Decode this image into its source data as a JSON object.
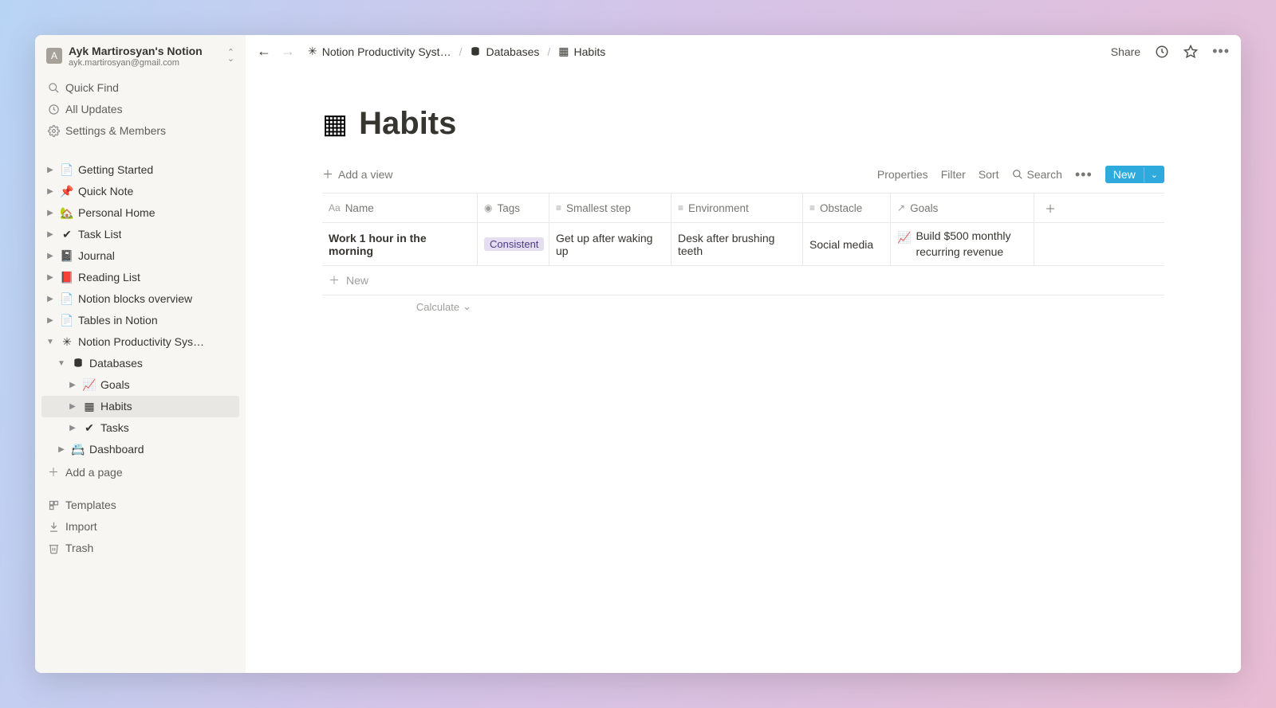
{
  "workspace": {
    "avatar_letter": "A",
    "title": "Ayk Martirosyan's Notion",
    "email": "ayk.martirosyan@gmail.com"
  },
  "sidebar": {
    "quick_find": "Quick Find",
    "all_updates": "All Updates",
    "settings": "Settings & Members",
    "pages": [
      {
        "icon": "📄",
        "label": "Getting Started"
      },
      {
        "icon": "📌",
        "label": "Quick Note"
      },
      {
        "icon": "🏡",
        "label": "Personal Home"
      },
      {
        "icon": "✔",
        "label": "Task List"
      },
      {
        "icon": "📓",
        "label": "Journal"
      },
      {
        "icon": "📕",
        "label": "Reading List"
      },
      {
        "icon": "📄",
        "label": "Notion blocks overview"
      },
      {
        "icon": "📄",
        "label": "Tables in Notion"
      }
    ],
    "productivity": {
      "icon": "✳",
      "label": "Notion Productivity Sys…",
      "databases_label": "Databases",
      "children": [
        {
          "icon": "📈",
          "label": "Goals"
        },
        {
          "icon": "▦",
          "label": "Habits",
          "active": true
        },
        {
          "icon": "✔",
          "label": "Tasks"
        }
      ],
      "dashboard": {
        "icon": "📇",
        "label": "Dashboard"
      }
    },
    "add_page": "Add a page",
    "templates": "Templates",
    "import": "Import",
    "trash": "Trash"
  },
  "breadcrumb": {
    "item1": "Notion Productivity Syst…",
    "item2": "Databases",
    "item3": "Habits"
  },
  "topbar": {
    "share": "Share"
  },
  "page": {
    "title": "Habits",
    "add_view": "Add a view",
    "properties": "Properties",
    "filter": "Filter",
    "sort": "Sort",
    "search": "Search",
    "new": "New",
    "columns": {
      "name": "Name",
      "tags": "Tags",
      "smallest_step": "Smallest step",
      "environment": "Environment",
      "obstacle": "Obstacle",
      "goals": "Goals"
    },
    "rows": [
      {
        "name": "Work 1 hour in the morning",
        "tag": "Consistent",
        "smallest_step": "Get up after waking up",
        "environment": "Desk after brushing teeth",
        "obstacle": "Social media",
        "goal": "Build $500 monthly recurring revenue"
      }
    ],
    "new_row": "New",
    "calculate": "Calculate"
  }
}
